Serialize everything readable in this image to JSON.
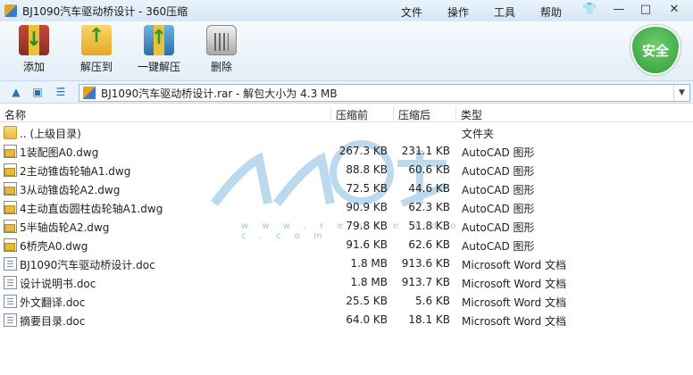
{
  "window": {
    "title": "BJ1090汽车驱动桥设计 - 360压缩",
    "menu": [
      "文件",
      "操作",
      "工具",
      "帮助"
    ],
    "controls": [
      "—",
      "□",
      "✕"
    ]
  },
  "toolbar": {
    "add": "添加",
    "extract": "解压到",
    "one_click": "一键解压",
    "delete": "删除",
    "security": "安全"
  },
  "address": {
    "text": "BJ1090汽车驱动桥设计.rar - 解包大小为 4.3 MB"
  },
  "columns": {
    "name": "名称",
    "compressed_before": "压缩前",
    "compressed_after": "压缩后",
    "type": "类型"
  },
  "watermark": {
    "text": "w w w . r e n r e n d o c . c o m"
  },
  "files": [
    {
      "icon": "folder",
      "name": ".. (上级目录)",
      "before": "",
      "after": "",
      "type": "文件夹"
    },
    {
      "icon": "dwg",
      "name": "1装配图A0.dwg",
      "before": "267.3 KB",
      "after": "231.1 KB",
      "type": "AutoCAD 图形"
    },
    {
      "icon": "dwg",
      "name": "2主动锥齿轮轴A1.dwg",
      "before": "88.8 KB",
      "after": "60.6 KB",
      "type": "AutoCAD 图形"
    },
    {
      "icon": "dwg",
      "name": "3从动锥齿轮A2.dwg",
      "before": "72.5 KB",
      "after": "44.6 KB",
      "type": "AutoCAD 图形"
    },
    {
      "icon": "dwg",
      "name": "4主动直齿圆柱齿轮轴A1.dwg",
      "before": "90.9 KB",
      "after": "62.3 KB",
      "type": "AutoCAD 图形"
    },
    {
      "icon": "dwg",
      "name": "5半轴齿轮A2.dwg",
      "before": "79.8 KB",
      "after": "51.8 KB",
      "type": "AutoCAD 图形"
    },
    {
      "icon": "dwg",
      "name": "6桥壳A0.dwg",
      "before": "91.6 KB",
      "after": "62.6 KB",
      "type": "AutoCAD 图形"
    },
    {
      "icon": "doc",
      "name": "BJ1090汽车驱动桥设计.doc",
      "before": "1.8 MB",
      "after": "913.6 KB",
      "type": "Microsoft Word 文档"
    },
    {
      "icon": "doc",
      "name": "设计说明书.doc",
      "before": "1.8 MB",
      "after": "913.7 KB",
      "type": "Microsoft Word 文档"
    },
    {
      "icon": "doc",
      "name": "外文翻译.doc",
      "before": "25.5 KB",
      "after": "5.6 KB",
      "type": "Microsoft Word 文档"
    },
    {
      "icon": "doc",
      "name": "摘要目录.doc",
      "before": "64.0 KB",
      "after": "18.1 KB",
      "type": "Microsoft Word 文档"
    }
  ]
}
